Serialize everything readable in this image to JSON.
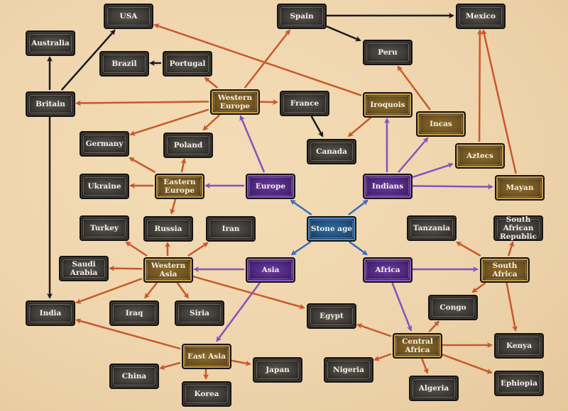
{
  "colors": {
    "orange": "#c8582a",
    "black": "#1a1a1a",
    "purple": "#8a4fc0",
    "blue": "#3a6ac0"
  },
  "nodes": {
    "usa": {
      "label": "USA",
      "style": "dark"
    },
    "australia": {
      "label": "Australia",
      "style": "dark"
    },
    "brazil": {
      "label": "Brazil",
      "style": "dark"
    },
    "portugal": {
      "label": "Portugal",
      "style": "dark"
    },
    "britain": {
      "label": "Britain",
      "style": "dark"
    },
    "western_europe": {
      "label": "Western Europe",
      "style": "gold"
    },
    "france": {
      "label": "France",
      "style": "dark"
    },
    "spain": {
      "label": "Spain",
      "style": "dark"
    },
    "mexico": {
      "label": "Mexico",
      "style": "dark"
    },
    "peru": {
      "label": "Peru",
      "style": "dark"
    },
    "iroquois": {
      "label": "Iroquois",
      "style": "gold"
    },
    "incas": {
      "label": "Incas",
      "style": "gold"
    },
    "germany": {
      "label": "Germany",
      "style": "dark"
    },
    "poland": {
      "label": "Poland",
      "style": "dark"
    },
    "canada": {
      "label": "Canada",
      "style": "dark"
    },
    "aztecs": {
      "label": "Aztecs",
      "style": "gold"
    },
    "eastern_europe": {
      "label": "Eastern Europe",
      "style": "gold"
    },
    "ukraine": {
      "label": "Ukraine",
      "style": "dark"
    },
    "europe": {
      "label": "Europe",
      "style": "purple"
    },
    "indians": {
      "label": "Indians",
      "style": "purple"
    },
    "mayan": {
      "label": "Mayan",
      "style": "gold"
    },
    "stone_age": {
      "label": "Stone age",
      "style": "blue"
    },
    "turkey": {
      "label": "Turkey",
      "style": "dark"
    },
    "russia": {
      "label": "Russia",
      "style": "dark"
    },
    "iran": {
      "label": "Iran",
      "style": "dark"
    },
    "tanzania": {
      "label": "Tanzania",
      "style": "dark"
    },
    "south_african_republic": {
      "label": "South African Republic",
      "style": "dark"
    },
    "saudi_arabia": {
      "label": "Saudi Arabia",
      "style": "dark"
    },
    "western_asia": {
      "label": "Western Asia",
      "style": "gold"
    },
    "asia": {
      "label": "Asia",
      "style": "purple"
    },
    "africa": {
      "label": "Africa",
      "style": "purple"
    },
    "south_africa": {
      "label": "South Africa",
      "style": "gold"
    },
    "india": {
      "label": "India",
      "style": "dark"
    },
    "iraq": {
      "label": "Iraq",
      "style": "dark"
    },
    "siria": {
      "label": "Siria",
      "style": "dark"
    },
    "egypt": {
      "label": "Egypt",
      "style": "dark"
    },
    "congo": {
      "label": "Congo",
      "style": "dark"
    },
    "central_africa": {
      "label": "Central Africa",
      "style": "gold"
    },
    "kenya": {
      "label": "Kenya",
      "style": "dark"
    },
    "east_asia": {
      "label": "East Asia",
      "style": "gold"
    },
    "japan": {
      "label": "Japan",
      "style": "dark"
    },
    "china": {
      "label": "China",
      "style": "dark"
    },
    "korea": {
      "label": "Korea",
      "style": "dark"
    },
    "nigeria": {
      "label": "Nigeria",
      "style": "dark"
    },
    "algeria": {
      "label": "Algeria",
      "style": "dark"
    },
    "ephiopia": {
      "label": "Ephiopia",
      "style": "dark"
    }
  },
  "edges": [
    [
      "britain",
      "usa",
      "black"
    ],
    [
      "britain",
      "australia",
      "black"
    ],
    [
      "britain",
      "india",
      "black"
    ],
    [
      "western_europe",
      "britain",
      "orange"
    ],
    [
      "western_europe",
      "portugal",
      "orange"
    ],
    [
      "western_europe",
      "spain",
      "orange"
    ],
    [
      "western_europe",
      "france",
      "orange"
    ],
    [
      "western_europe",
      "germany",
      "orange"
    ],
    [
      "western_europe",
      "poland",
      "orange"
    ],
    [
      "portugal",
      "brazil",
      "black"
    ],
    [
      "spain",
      "mexico",
      "black"
    ],
    [
      "spain",
      "peru",
      "black"
    ],
    [
      "iroquois",
      "usa",
      "orange"
    ],
    [
      "iroquois",
      "canada",
      "orange"
    ],
    [
      "france",
      "canada",
      "black"
    ],
    [
      "incas",
      "peru",
      "orange"
    ],
    [
      "aztecs",
      "mexico",
      "orange"
    ],
    [
      "mayan",
      "mexico",
      "orange"
    ],
    [
      "indians",
      "iroquois",
      "purple"
    ],
    [
      "indians",
      "incas",
      "purple"
    ],
    [
      "indians",
      "aztecs",
      "purple"
    ],
    [
      "indians",
      "mayan",
      "purple"
    ],
    [
      "europe",
      "western_europe",
      "purple"
    ],
    [
      "europe",
      "eastern_europe",
      "purple"
    ],
    [
      "eastern_europe",
      "germany",
      "orange"
    ],
    [
      "eastern_europe",
      "poland",
      "orange"
    ],
    [
      "eastern_europe",
      "ukraine",
      "orange"
    ],
    [
      "eastern_europe",
      "russia",
      "orange"
    ],
    [
      "stone_age",
      "europe",
      "blue"
    ],
    [
      "stone_age",
      "indians",
      "blue"
    ],
    [
      "stone_age",
      "asia",
      "blue"
    ],
    [
      "stone_age",
      "africa",
      "blue"
    ],
    [
      "asia",
      "western_asia",
      "purple"
    ],
    [
      "asia",
      "east_asia",
      "purple"
    ],
    [
      "western_asia",
      "turkey",
      "orange"
    ],
    [
      "western_asia",
      "russia",
      "orange"
    ],
    [
      "western_asia",
      "iran",
      "orange"
    ],
    [
      "western_asia",
      "saudi_arabia",
      "orange"
    ],
    [
      "western_asia",
      "india",
      "orange"
    ],
    [
      "western_asia",
      "iraq",
      "orange"
    ],
    [
      "western_asia",
      "siria",
      "orange"
    ],
    [
      "western_asia",
      "egypt",
      "orange"
    ],
    [
      "east_asia",
      "india",
      "orange"
    ],
    [
      "east_asia",
      "china",
      "orange"
    ],
    [
      "east_asia",
      "korea",
      "orange"
    ],
    [
      "east_asia",
      "japan",
      "orange"
    ],
    [
      "africa",
      "south_africa",
      "purple"
    ],
    [
      "africa",
      "central_africa",
      "purple"
    ],
    [
      "south_africa",
      "tanzania",
      "orange"
    ],
    [
      "south_africa",
      "south_african_republic",
      "orange"
    ],
    [
      "south_africa",
      "congo",
      "orange"
    ],
    [
      "south_africa",
      "kenya",
      "orange"
    ],
    [
      "central_africa",
      "egypt",
      "orange"
    ],
    [
      "central_africa",
      "congo",
      "orange"
    ],
    [
      "central_africa",
      "kenya",
      "orange"
    ],
    [
      "central_africa",
      "ephiopia",
      "orange"
    ],
    [
      "central_africa",
      "algeria",
      "orange"
    ],
    [
      "central_africa",
      "nigeria",
      "orange"
    ]
  ]
}
